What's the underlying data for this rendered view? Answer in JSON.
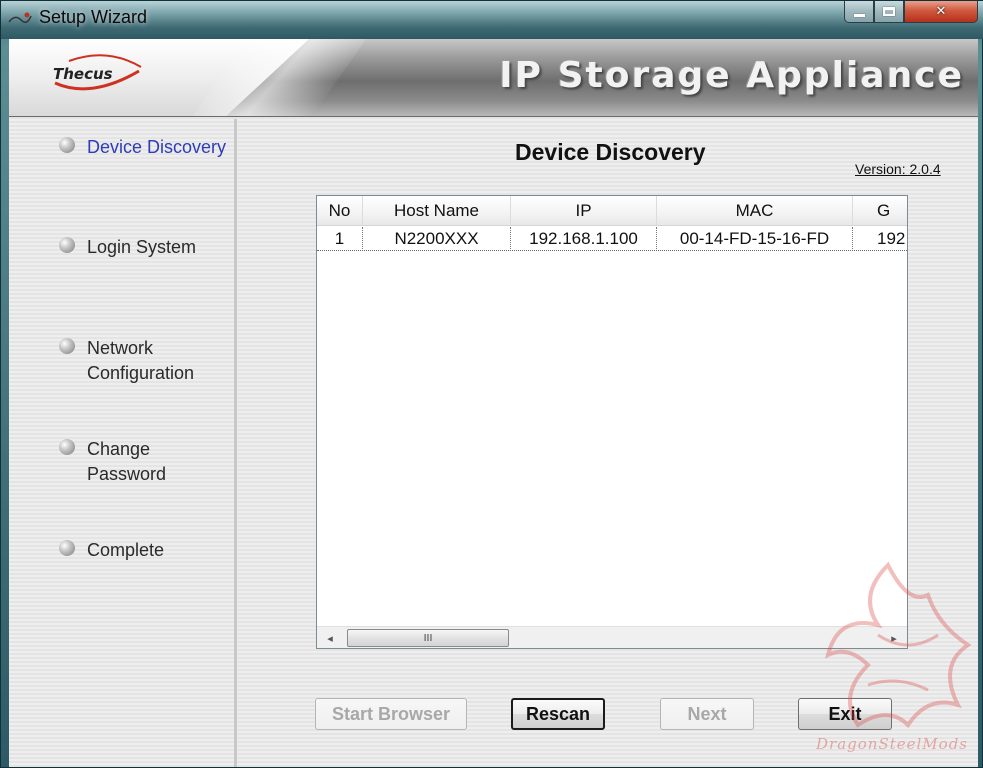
{
  "window": {
    "title": "Setup Wizard",
    "controls": {
      "minimize": "minimize",
      "maximize": "maximize",
      "close": "close"
    }
  },
  "banner": {
    "logo_text": "Thecus",
    "title": "IP Storage Appliance"
  },
  "sidebar": {
    "steps": [
      {
        "label": "Device Discovery",
        "active": true
      },
      {
        "label": "Login System",
        "active": false
      },
      {
        "label": "Network Configuration",
        "active": false
      },
      {
        "label": "Change Password",
        "active": false
      },
      {
        "label": "Complete",
        "active": false
      }
    ]
  },
  "main": {
    "title": "Device Discovery",
    "version": "Version: 2.0.4",
    "table": {
      "columns": [
        "No",
        "Host Name",
        "IP",
        "MAC",
        "G"
      ],
      "rows": [
        [
          "1",
          "N2200XXX",
          "192.168.1.100",
          "00-14-FD-15-16-FD",
          "192"
        ]
      ]
    },
    "scrollbar": {
      "thumb_grip": "III",
      "left_arrow": "◂",
      "right_arrow": "▸"
    }
  },
  "buttons": {
    "start_browser": "Start Browser",
    "rescan": "Rescan",
    "next": "Next",
    "exit": "Exit"
  },
  "watermark": {
    "text": "DragonSteelMods"
  },
  "colors": {
    "active_step": "#2e3cb8",
    "close_button": "#c23a20",
    "disabled_text": "#a8a8a8"
  }
}
